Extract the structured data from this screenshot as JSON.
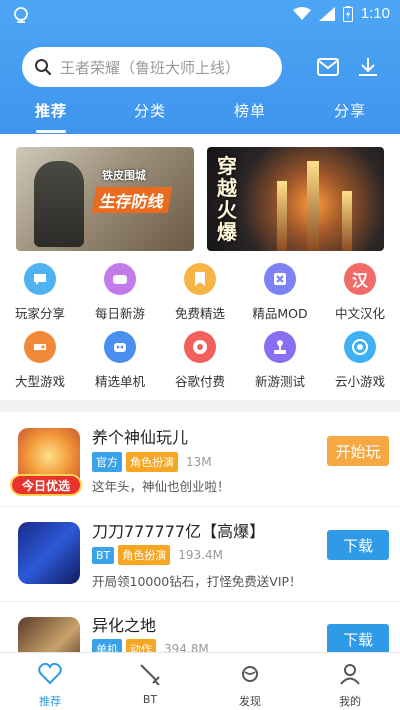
{
  "status": {
    "time": "1:10"
  },
  "search": {
    "placeholder": "王者荣耀（鲁班大师上线）"
  },
  "tabs": [
    "推荐",
    "分类",
    "榜单",
    "分享"
  ],
  "banners": [
    {
      "title": "生存防线",
      "brand": "铁皮围城"
    },
    {
      "title": "穿越火爆"
    }
  ],
  "categories": [
    {
      "label": "玩家分享",
      "icon": "chat-bubble-icon",
      "color": "#4fb3f2"
    },
    {
      "label": "每日新游",
      "icon": "gamepad-icon",
      "color": "#c37bea"
    },
    {
      "label": "免费精选",
      "icon": "bookmark-icon",
      "color": "#f5b445"
    },
    {
      "label": "精品MOD",
      "icon": "mod-box-icon",
      "color": "#7d83f2"
    },
    {
      "label": "中文汉化",
      "icon": "han-character-icon",
      "color": "#f06a6a"
    },
    {
      "label": "大型游戏",
      "icon": "controller-icon",
      "color": "#f08a3a"
    },
    {
      "label": "精选单机",
      "icon": "robot-icon",
      "color": "#4a8ff0"
    },
    {
      "label": "谷歌付费",
      "icon": "chrome-icon",
      "color": "#f0615c"
    },
    {
      "label": "新游测试",
      "icon": "joystick-icon",
      "color": "#8a6ef2"
    },
    {
      "label": "云小游戏",
      "icon": "target-icon",
      "color": "#3fb0f2"
    }
  ],
  "games": [
    {
      "title": "养个神仙玩儿",
      "tags": [
        "官方",
        "角色扮演"
      ],
      "size": "13M",
      "desc": "这年头，神仙也创业啦！",
      "button": "开始玩"
    },
    {
      "title": "刀刀777777亿【高爆】",
      "tags": [
        "BT",
        "角色扮演"
      ],
      "size": "193.4M",
      "desc": "开局领10000钻石，打怪免费送VIP！",
      "button": "下载"
    },
    {
      "title": "异化之地",
      "tags": [
        "单机",
        "动作"
      ],
      "size": "394.8M",
      "desc": "",
      "button": "下载"
    }
  ],
  "badge": "今日优选",
  "bottom_nav": [
    "推荐",
    "BT",
    "发现",
    "我的"
  ],
  "colors": {
    "accent": "#3f95ec",
    "download": "#2f9ae6",
    "play": "#f5a742"
  }
}
